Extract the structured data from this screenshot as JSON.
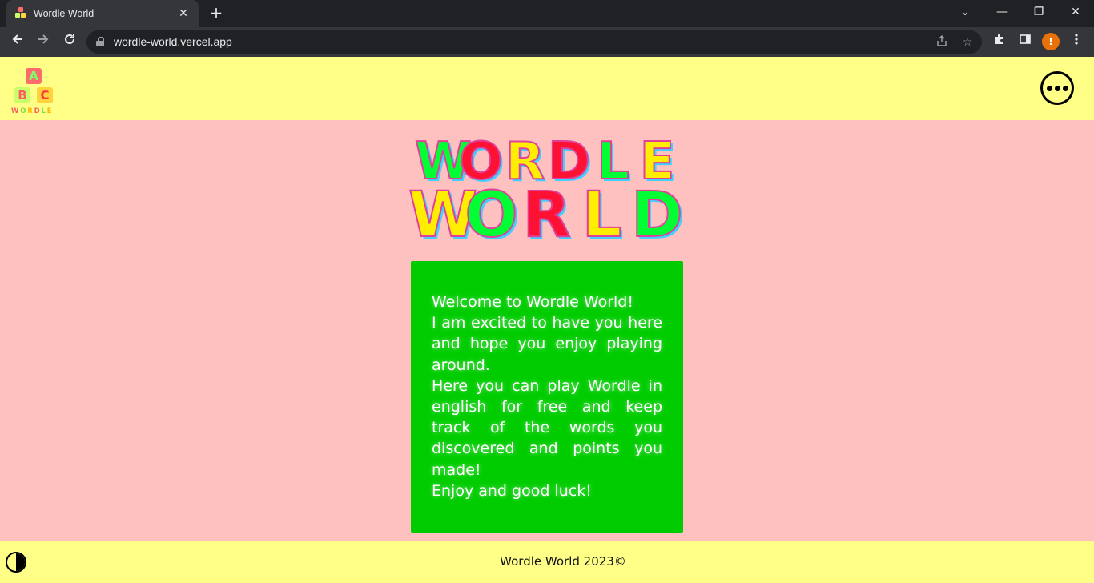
{
  "browser": {
    "tab_title": "Wordle World",
    "tab_close": "✕",
    "new_tab": "+",
    "url": "wordle-world.vercel.app",
    "profile_initial": "!",
    "window_controls": {
      "dropdown": "⌄",
      "minimize": "—",
      "restore": "❐",
      "close": "✕"
    }
  },
  "header": {
    "logo_blocks": [
      {
        "letter": "A",
        "bg": "#ff6b6b",
        "fg": "#7dff6b"
      },
      {
        "letter": "B",
        "bg": "#c8ff6b",
        "fg": "#ff5e5e"
      },
      {
        "letter": "C",
        "bg": "#ffd23f",
        "fg": "#ff3b3b"
      }
    ],
    "logo_word": "WORDLE",
    "menu_icon": "more-horizontal-icon"
  },
  "hero": {
    "line1": [
      "W",
      "O",
      "R",
      "D",
      "L",
      "E"
    ],
    "line2": [
      "W",
      "O",
      "R",
      "L",
      "D"
    ],
    "line1_colors": [
      "#00ff33",
      "#ff1133",
      "#ffee00",
      "#ff1133",
      "#00ff33",
      "#ffee00"
    ],
    "line2_colors": [
      "#ffee00",
      "#00ff33",
      "#ff1133",
      "#ffee00",
      "#00ff33"
    ]
  },
  "welcome": {
    "line1": "Welcome to Wordle World!",
    "line2": "I am excited to have you here and hope you enjoy playing around.",
    "line3": "Here you can play Wordle in english for free and keep track of the words you discovered and points you made!",
    "line4": "Enjoy and good luck!"
  },
  "footer": {
    "copyright": "Wordle World 2023©",
    "theme_toggle_icon": "contrast-icon"
  },
  "colors": {
    "header_bg": "#ffff88",
    "page_bg": "#ffc0c0",
    "card_bg": "#00cc00"
  }
}
